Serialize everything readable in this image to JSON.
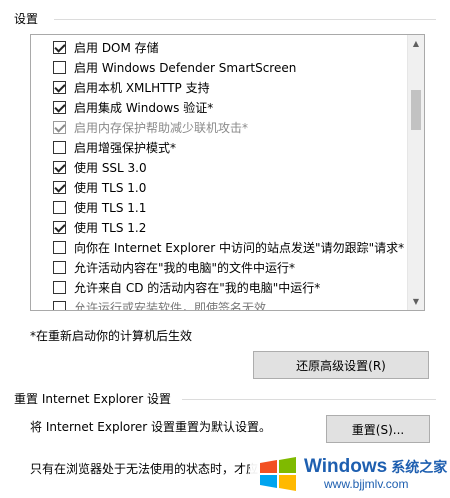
{
  "settings_group": {
    "label": "设置"
  },
  "options": [
    {
      "label": "启用 DOM 存储",
      "checked": true,
      "disabled": false
    },
    {
      "label": "启用 Windows Defender SmartScreen",
      "checked": false,
      "disabled": false
    },
    {
      "label": "启用本机 XMLHTTP 支持",
      "checked": true,
      "disabled": false
    },
    {
      "label": "启用集成 Windows 验证*",
      "checked": true,
      "disabled": false
    },
    {
      "label": "启用内存保护帮助减少联机攻击*",
      "checked": true,
      "disabled": true
    },
    {
      "label": "启用增强保护模式*",
      "checked": false,
      "disabled": false
    },
    {
      "label": "使用 SSL 3.0",
      "checked": true,
      "disabled": false
    },
    {
      "label": "使用 TLS 1.0",
      "checked": true,
      "disabled": false
    },
    {
      "label": "使用 TLS 1.1",
      "checked": false,
      "disabled": false
    },
    {
      "label": "使用 TLS 1.2",
      "checked": true,
      "disabled": false
    },
    {
      "label": "向你在 Internet Explorer 中访问的站点发送\"请勿跟踪\"请求*",
      "checked": false,
      "disabled": false
    },
    {
      "label": "允许活动内容在\"我的电脑\"的文件中运行*",
      "checked": false,
      "disabled": false
    },
    {
      "label": "允许来自 CD 的活动内容在\"我的电脑\"中运行*",
      "checked": false,
      "disabled": false
    },
    {
      "label": "允许运行或安装软件，即使签名无效",
      "checked": false,
      "disabled": false
    }
  ],
  "restart_note": "*在重新启动你的计算机后生效",
  "restore_button": "还原高级设置(R)",
  "reset_group": {
    "label": "重置 Internet Explorer 设置",
    "description": "将 Internet Explorer 设置重置为默认设置。",
    "button": "重置(S)...",
    "note": "只有在浏览器处于无法使用的状态时，才应"
  },
  "watermark": {
    "brand": "Windows",
    "suffix": "系统之家",
    "url": "www.bjjmlv.com",
    "colors": {
      "red": "#f25022",
      "green": "#7fba00",
      "blue": "#00a4ef",
      "yellow": "#ffb900",
      "text": "#1e5fb0"
    }
  }
}
